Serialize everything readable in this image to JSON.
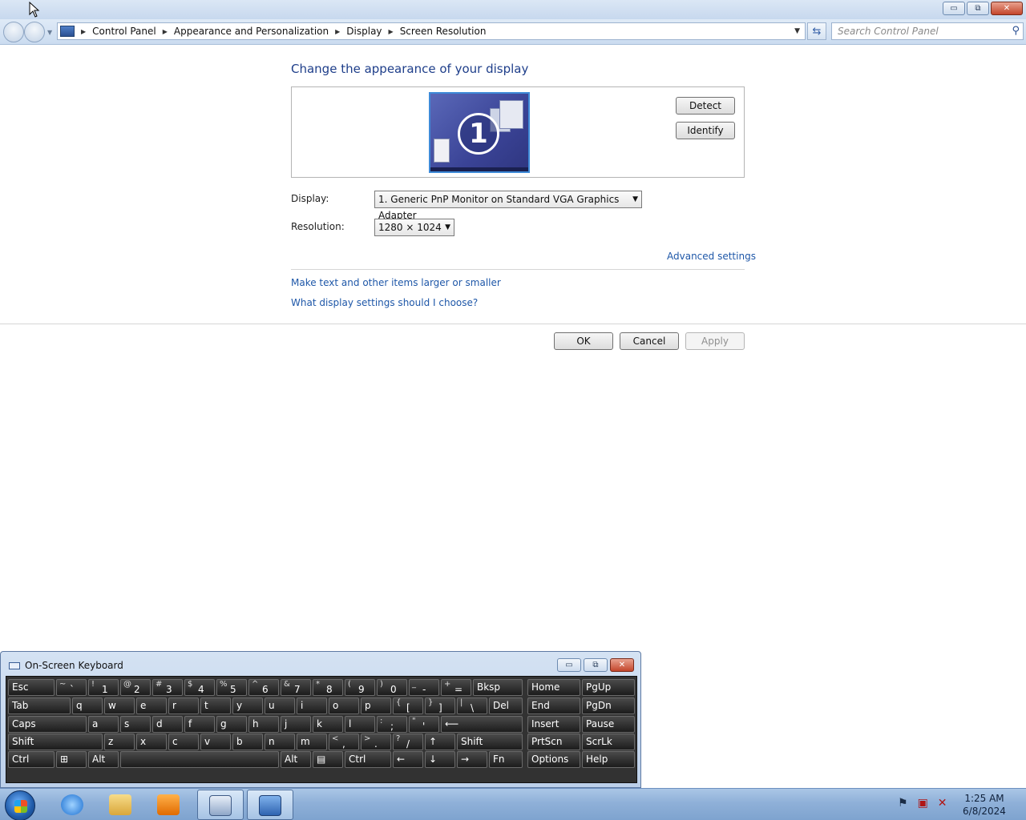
{
  "window": {
    "minimize": "▭",
    "restore": "⧉",
    "close": "✕"
  },
  "breadcrumb": [
    "Control Panel",
    "Appearance and Personalization",
    "Display",
    "Screen Resolution"
  ],
  "search": {
    "placeholder": "Search Control Panel"
  },
  "main": {
    "heading": "Change the appearance of your display",
    "monitor_number": "1",
    "detect_label": "Detect",
    "identify_label": "Identify",
    "display_label": "Display:",
    "display_value": "1. Generic PnP Monitor on Standard VGA Graphics Adapter",
    "resolution_label": "Resolution:",
    "resolution_value": "1280 × 1024",
    "advanced_link": "Advanced settings",
    "link_text_size": "Make text and other items larger or smaller",
    "link_help": "What display settings should I choose?",
    "ok_label": "OK",
    "cancel_label": "Cancel",
    "apply_label": "Apply"
  },
  "osk": {
    "title": "On-Screen Keyboard",
    "rows": [
      [
        {
          "m": "Esc"
        },
        {
          "s": "~",
          "m": "`"
        },
        {
          "s": "!",
          "m": "1"
        },
        {
          "s": "@",
          "m": "2"
        },
        {
          "s": "#",
          "m": "3"
        },
        {
          "s": "$",
          "m": "4"
        },
        {
          "s": "%",
          "m": "5"
        },
        {
          "s": "^",
          "m": "6"
        },
        {
          "s": "&",
          "m": "7"
        },
        {
          "s": "*",
          "m": "8"
        },
        {
          "s": "(",
          "m": "9"
        },
        {
          "s": ")",
          "m": "0"
        },
        {
          "s": "_",
          "m": "-"
        },
        {
          "s": "+",
          "m": "="
        },
        {
          "m": "Bksp"
        },
        {
          "m": "Home"
        },
        {
          "m": "PgUp"
        }
      ],
      [
        {
          "m": "Tab"
        },
        {
          "m": "q"
        },
        {
          "m": "w"
        },
        {
          "m": "e"
        },
        {
          "m": "r"
        },
        {
          "m": "t"
        },
        {
          "m": "y"
        },
        {
          "m": "u"
        },
        {
          "m": "i"
        },
        {
          "m": "o"
        },
        {
          "m": "p"
        },
        {
          "s": "{",
          "m": "["
        },
        {
          "s": "}",
          "m": "]"
        },
        {
          "s": "|",
          "m": "\\"
        },
        {
          "m": "Del"
        },
        {
          "m": "End"
        },
        {
          "m": "PgDn"
        }
      ],
      [
        {
          "m": "Caps"
        },
        {
          "m": "a"
        },
        {
          "m": "s"
        },
        {
          "m": "d"
        },
        {
          "m": "f"
        },
        {
          "m": "g"
        },
        {
          "m": "h"
        },
        {
          "m": "j"
        },
        {
          "m": "k"
        },
        {
          "m": "l"
        },
        {
          "s": ":",
          "m": ";"
        },
        {
          "s": "\"",
          "m": "'"
        },
        {
          "m": "⟵"
        },
        {
          "m": "Insert"
        },
        {
          "m": "Pause"
        }
      ],
      [
        {
          "m": "Shift"
        },
        {
          "m": "z"
        },
        {
          "m": "x"
        },
        {
          "m": "c"
        },
        {
          "m": "v"
        },
        {
          "m": "b"
        },
        {
          "m": "n"
        },
        {
          "m": "m"
        },
        {
          "s": "<",
          "m": ","
        },
        {
          "s": ">",
          "m": "."
        },
        {
          "s": "?",
          "m": "/"
        },
        {
          "m": "↑"
        },
        {
          "m": "Shift"
        },
        {
          "m": "PrtScn"
        },
        {
          "m": "ScrLk"
        }
      ],
      [
        {
          "m": "Ctrl"
        },
        {
          "m": "⊞"
        },
        {
          "m": "Alt"
        },
        {
          "m": ""
        },
        {
          "m": "Alt"
        },
        {
          "m": "▤"
        },
        {
          "m": "Ctrl"
        },
        {
          "m": "←"
        },
        {
          "m": "↓"
        },
        {
          "m": "→"
        },
        {
          "m": "Fn"
        },
        {
          "m": "Options"
        },
        {
          "m": "Help"
        }
      ]
    ]
  },
  "taskbar": {
    "time": "1:25 AM",
    "date": "6/8/2024"
  }
}
